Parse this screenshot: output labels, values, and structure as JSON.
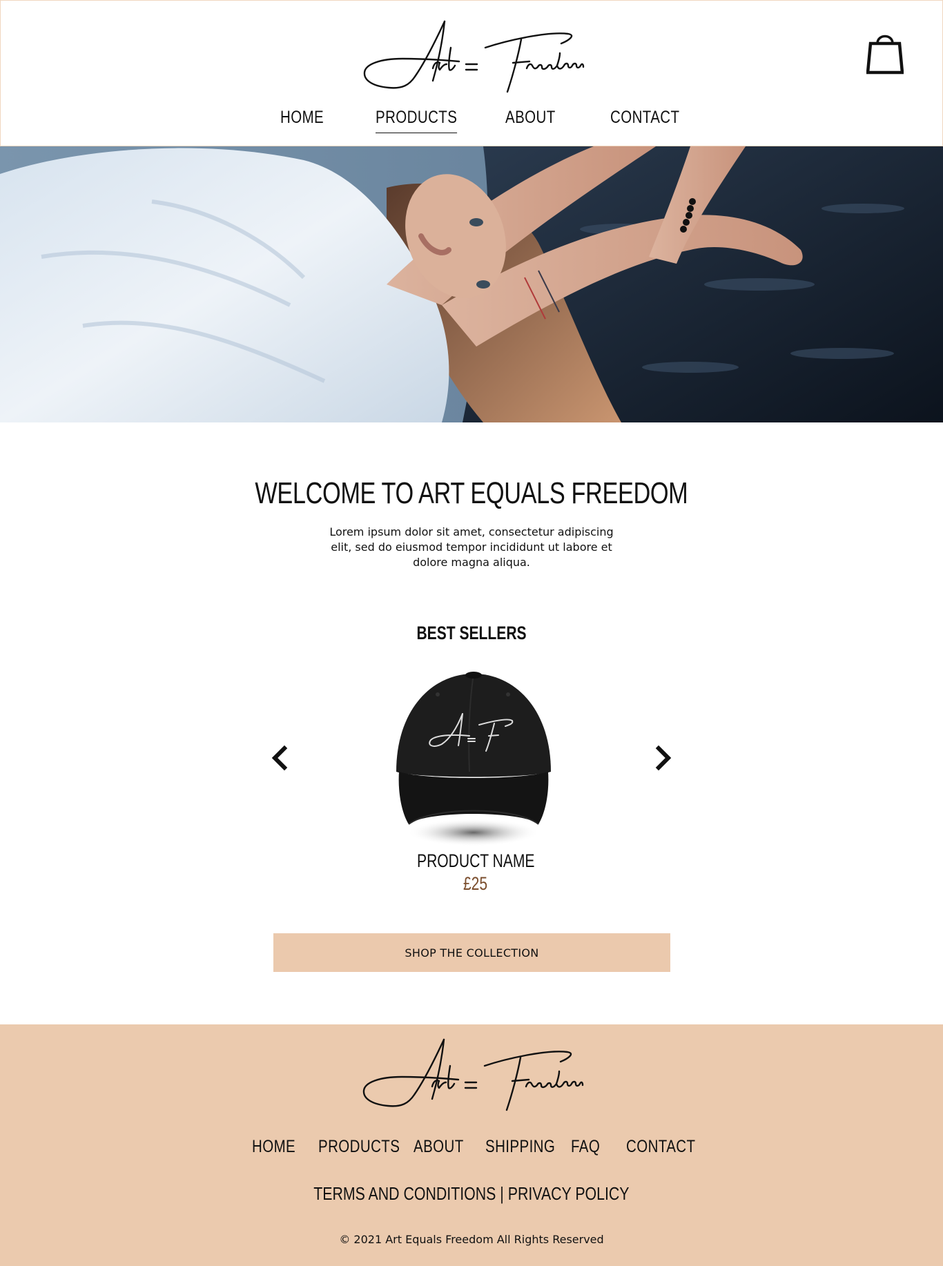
{
  "header": {
    "logo_text": "Art = Freedom",
    "cart_icon": "shopping-bag-icon",
    "nav": [
      {
        "label": "HOME",
        "active": false
      },
      {
        "label": "PRODUCTS",
        "active": true
      },
      {
        "label": "ABOUT",
        "active": false
      },
      {
        "label": "CONTACT",
        "active": false
      }
    ]
  },
  "hero": {
    "image": "woman lying with arms raised wearing white t-shirt"
  },
  "welcome": {
    "title": "WELCOME TO ART EQUALS FREEDOM",
    "text": "Lorem ipsum dolor sit amet, consectetur adipiscing elit, sed do eiusmod tempor incididunt ut labore et dolore magna aliqua."
  },
  "best_sellers": {
    "title": "BEST SELLERS",
    "prev_icon": "chevron-left-icon",
    "next_icon": "chevron-right-icon",
    "product": {
      "image": "black cap with A=F logo",
      "logo_text": "A=F",
      "name": "PRODUCT NAME",
      "price": "£25"
    },
    "button_label": "SHOP THE COLLECTION"
  },
  "footer": {
    "logo_text": "Art = Freedom",
    "nav": [
      "HOME",
      "PRODUCTS",
      "ABOUT",
      "SHIPPING",
      "FAQ",
      "CONTACT"
    ],
    "terms_label": "TERMS AND CONDITIONS",
    "separator": "|",
    "privacy_label": "PRIVACY POLICY",
    "copyright": "© 2021 Art Equals Freedom All Rights Reserved"
  },
  "colors": {
    "accent": "#ebcaae",
    "price": "#7a4d2c",
    "text": "#111111"
  }
}
